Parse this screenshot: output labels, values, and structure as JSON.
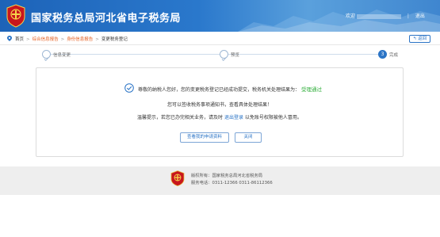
{
  "header": {
    "site_title": "国家税务总局河北省电子税务局",
    "user_prefix": "欢迎",
    "exit_label": "退出",
    "separator": "|"
  },
  "breadcrumb": {
    "items": [
      "首页",
      "综合信息报告",
      "身份信息报告",
      "变更税务登记"
    ],
    "link_color": "#e55e1f"
  },
  "back_label": "返回",
  "steps": [
    {
      "label": "信息变更",
      "state": "done"
    },
    {
      "label": "预览",
      "state": "done"
    },
    {
      "label": "完成",
      "state": "active",
      "number": "3"
    }
  ],
  "result": {
    "msg_prefix": "尊敬的纳税人您好，您的变更税务登记已经成功提交，税务机关处理结果为：",
    "status": "受理通过",
    "status_color": "#2fae3a",
    "msg2": "您可以签收税务事项通知书，查看具体处理结果！",
    "msg3_prefix": "温馨提示，若您已办完相关业务，请及时",
    "msg3_link": "退出登录",
    "msg3_suffix": "以免账号权限被他人冒用。",
    "buttons": {
      "view": "查看我的申请资料",
      "close": "关闭"
    }
  },
  "footer": {
    "copyright": "版权所有：国家税务总局河北省税务局",
    "phone": "服务电话：0311-12366 0311-86112366"
  },
  "colors": {
    "brand_blue": "#2b74c6",
    "header_blue": "#1d63b8",
    "emblem_red": "#c8161d",
    "footer_bg": "#eeeeee"
  }
}
